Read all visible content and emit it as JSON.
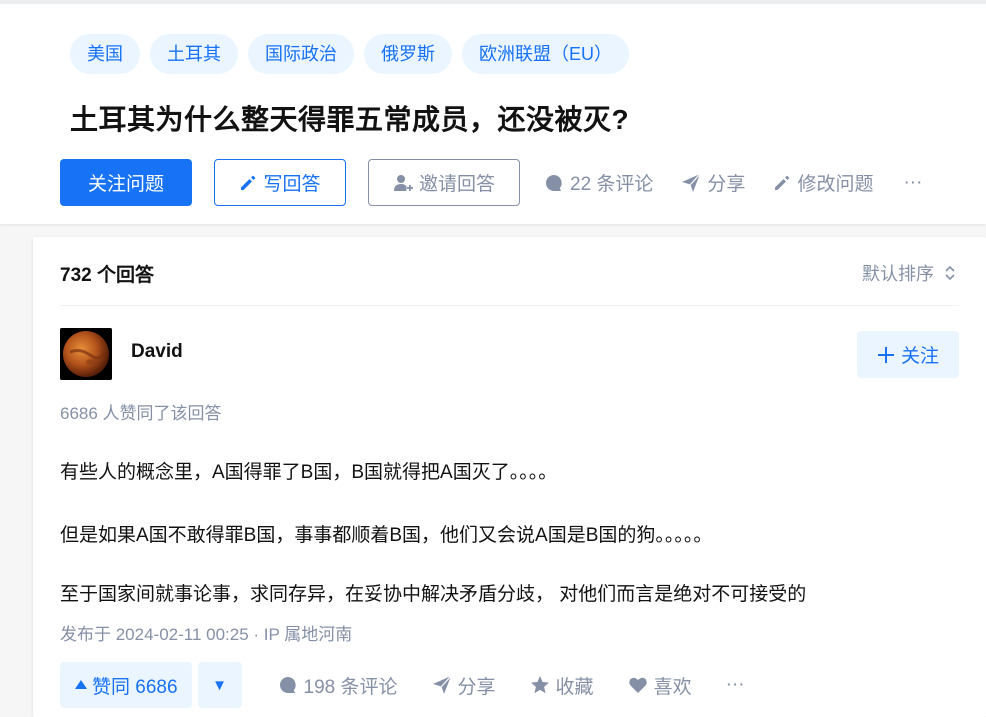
{
  "question": {
    "topics": [
      "美国",
      "土耳其",
      "国际政治",
      "俄罗斯",
      "欧洲联盟（EU）"
    ],
    "title": "土耳其为什么整天得罪五常成员，还没被灭?",
    "actions": {
      "follow": "关注问题",
      "write": "写回答",
      "invite": "邀请回答",
      "comments": "22 条评论",
      "share": "分享",
      "edit": "修改问题",
      "more": "···"
    }
  },
  "answers": {
    "count": "732 个回答",
    "sort": "默认排序",
    "item": {
      "author": "David",
      "follow": "关注",
      "upvote_summary": "6686 人赞同了该回答",
      "paragraphs": [
        "有些人的概念里，A国得罪了B国，B国就得把A国灭了。。。。",
        "但是如果A国不敢得罪B国，事事都顺着B国，他们又会说A国是B国的狗。。。。。",
        "至于国家间就事论事，求同存异，在妥协中解决矛盾分歧， 对他们而言是绝对不可接受的"
      ],
      "published": "发布于 2024-02-11 00:25 · IP 属地河南",
      "actions": {
        "upvote": "赞同 6686",
        "downvote": "▼",
        "comments": "198 条评论",
        "share": "分享",
        "collect": "收藏",
        "like": "喜欢",
        "more": "···"
      }
    }
  },
  "colors": {
    "brand": "#1772f6",
    "brand_light": "#ebf5ff",
    "meta": "#8590a6",
    "text": "#121212"
  },
  "icons": [
    "pencil-icon",
    "invite-user-icon",
    "comment-icon",
    "share-icon",
    "plus-icon",
    "sort-chevron-icon",
    "star-icon",
    "heart-icon"
  ]
}
